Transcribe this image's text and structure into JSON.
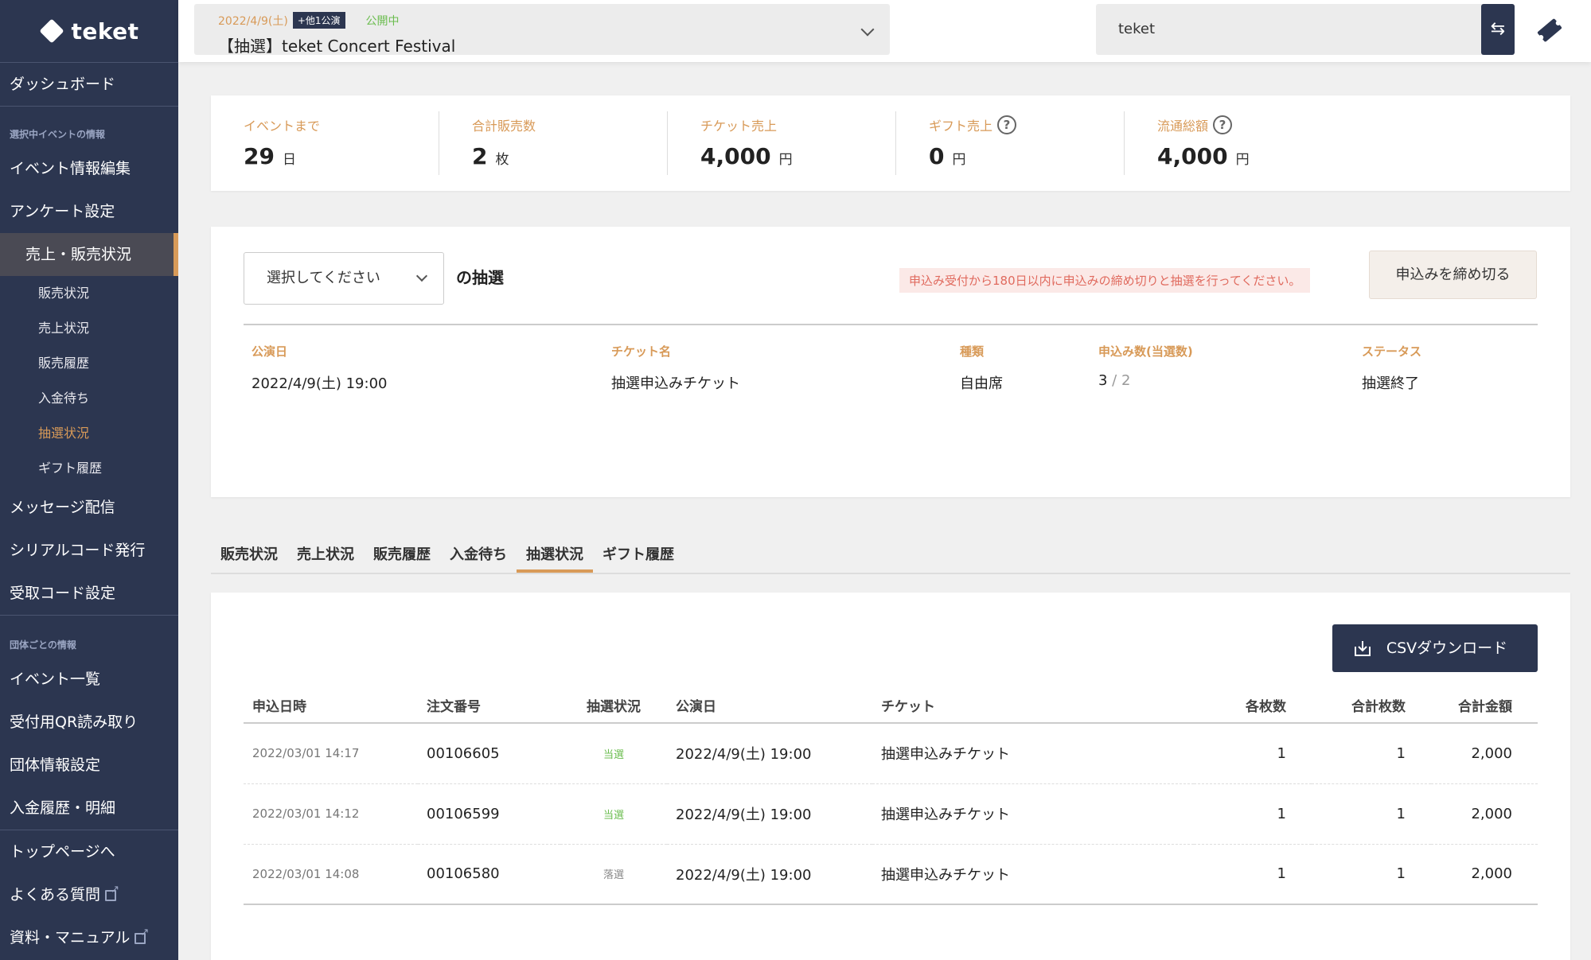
{
  "sidebar": {
    "brand": "teket",
    "dashboard": "ダッシュボード",
    "section1": "選択中イベントの情報",
    "items1": [
      "イベント情報編集",
      "アンケート設定"
    ],
    "sales_active": "売上・販売状況",
    "subitems": [
      "販売状況",
      "売上状況",
      "販売履歴",
      "入金待ち",
      "抽選状況",
      "ギフト履歴"
    ],
    "items1b": [
      "メッセージ配信",
      "シリアルコード発行",
      "受取コード設定"
    ],
    "section2": "団体ごとの情報",
    "items2": [
      "イベント一覧",
      "受付用QR読み取り",
      "団体情報設定",
      "入金履歴・明細"
    ],
    "items3": [
      "トップページへ",
      "よくある質問",
      "資料・マニュアル"
    ]
  },
  "topbar": {
    "event_date": "2022/4/9(土)",
    "event_badge": "+他1公演",
    "event_status": "公開中",
    "event_title": "【抽選】teket Concert Festival",
    "org_name": "teket"
  },
  "stats": [
    {
      "label": "イベントまで",
      "value": "29",
      "unit": "日",
      "help": false
    },
    {
      "label": "合計販売数",
      "value": "2",
      "unit": "枚",
      "help": false
    },
    {
      "label": "チケット売上",
      "value": "4,000",
      "unit": "円",
      "help": false
    },
    {
      "label": "ギフト売上",
      "value": "0",
      "unit": "円",
      "help": true
    },
    {
      "label": "流通総額",
      "value": "4,000",
      "unit": "円",
      "help": true
    }
  ],
  "lottery": {
    "select_placeholder": "選択してください",
    "of_label": "の抽選",
    "warning": "申込み受付から180日以内に申込みの締め切りと抽選を行ってください。",
    "close_button": "申込みを締め切る",
    "headers": {
      "date": "公演日",
      "ticket": "チケット名",
      "type": "種類",
      "count": "申込み数(当選数)",
      "status": "ステータス"
    },
    "row": {
      "date": "2022/4/9(土) 19:00",
      "ticket": "抽選申込みチケット",
      "type": "自由席",
      "applied": "3",
      "sep": " / ",
      "won": "2",
      "status": "抽選終了"
    }
  },
  "tabs": [
    "販売状況",
    "売上状況",
    "販売履歴",
    "入金待ち",
    "抽選状況",
    "ギフト履歴"
  ],
  "active_tab": "抽選状況",
  "csv_button": "CSVダウンロード",
  "table": {
    "columns": [
      "申込日時",
      "注文番号",
      "抽選状況",
      "公演日",
      "チケット",
      "各枚数",
      "合計枚数",
      "合計金額"
    ],
    "rows": [
      {
        "applied_at": "2022/03/01 14:17",
        "order": "00106605",
        "status": "当選",
        "date": "2022/4/9(土) 19:00",
        "ticket": "抽選申込みチケット",
        "each": "1",
        "total_qty": "1",
        "amount": "2,000"
      },
      {
        "applied_at": "2022/03/01 14:12",
        "order": "00106599",
        "status": "当選",
        "date": "2022/4/9(土) 19:00",
        "ticket": "抽選申込みチケット",
        "each": "1",
        "total_qty": "1",
        "amount": "2,000"
      },
      {
        "applied_at": "2022/03/01 14:08",
        "order": "00106580",
        "status": "落選",
        "date": "2022/4/9(土) 19:00",
        "ticket": "抽選申込みチケット",
        "each": "1",
        "total_qty": "1",
        "amount": "2,000"
      }
    ]
  },
  "colors": {
    "sidebar": "#2c3650",
    "accent": "#d89a58",
    "win": "#6bbd4f",
    "warning": "#e06a5e"
  }
}
